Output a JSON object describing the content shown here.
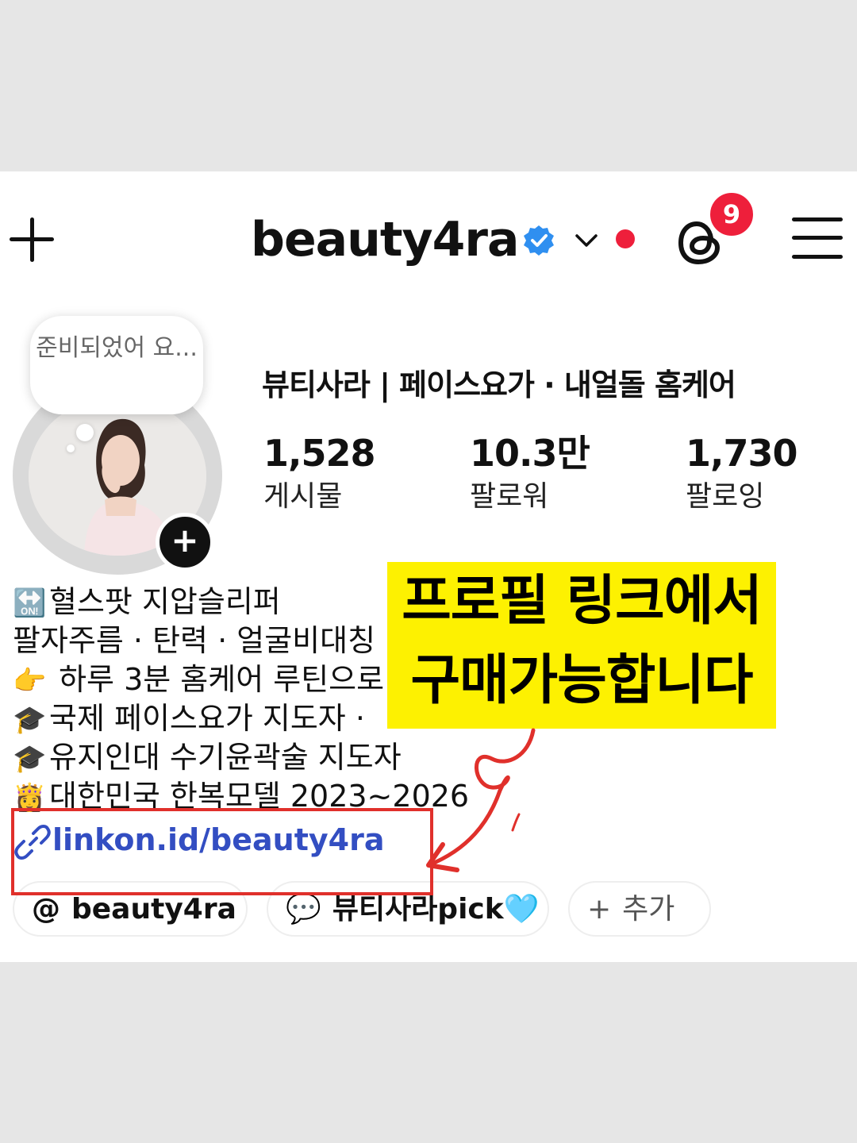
{
  "header": {
    "username": "beauty4ra",
    "threads_badge": "9",
    "icons": [
      "plus-icon",
      "verified-badge-icon",
      "chevron-down-icon",
      "threads-icon",
      "menu-icon"
    ]
  },
  "profile": {
    "note_bubble": "준비되었어 요...",
    "display_name": "뷰티사라 | 페이스요가 · 내얼돌 홈케어",
    "stats": [
      {
        "value": "1,528",
        "label": "게시물"
      },
      {
        "value": "10.3만",
        "label": "팔로워"
      },
      {
        "value": "1,730",
        "label": "팔로잉"
      }
    ]
  },
  "bio": {
    "lines": [
      {
        "emoji": "🔛",
        "text": "혈스팟 지압슬리퍼"
      },
      {
        "emoji": "",
        "text": "팔자주름 · 탄력 · 얼굴비대칭"
      },
      {
        "emoji": "👉",
        "text": " 하루 3분 홈케어 루틴으로"
      },
      {
        "emoji": "🎓",
        "text": "국제 페이스요가 지도자 ·"
      },
      {
        "emoji": "🎓",
        "text": "유지인대 수기윤곽술 지도자"
      },
      {
        "emoji": "👸",
        "text": "대한민국 한복모델 2023~2026"
      }
    ],
    "link": "linkon.id/beauty4ra"
  },
  "pills": [
    {
      "icon": "threads-icon",
      "label": "beauty4ra"
    },
    {
      "icon": "chat-icon",
      "label": "뷰티사라pick🩵"
    },
    {
      "icon": "plus-icon",
      "label": "추가"
    }
  ],
  "overlay": {
    "line1": "프로필 링크에서",
    "line2": "구매가능합니다"
  },
  "colors": {
    "accent_red": "#ee1f3b",
    "link_blue": "#334ec2",
    "highlight_yellow": "#fdf101",
    "annotation_red": "#e0302b"
  }
}
